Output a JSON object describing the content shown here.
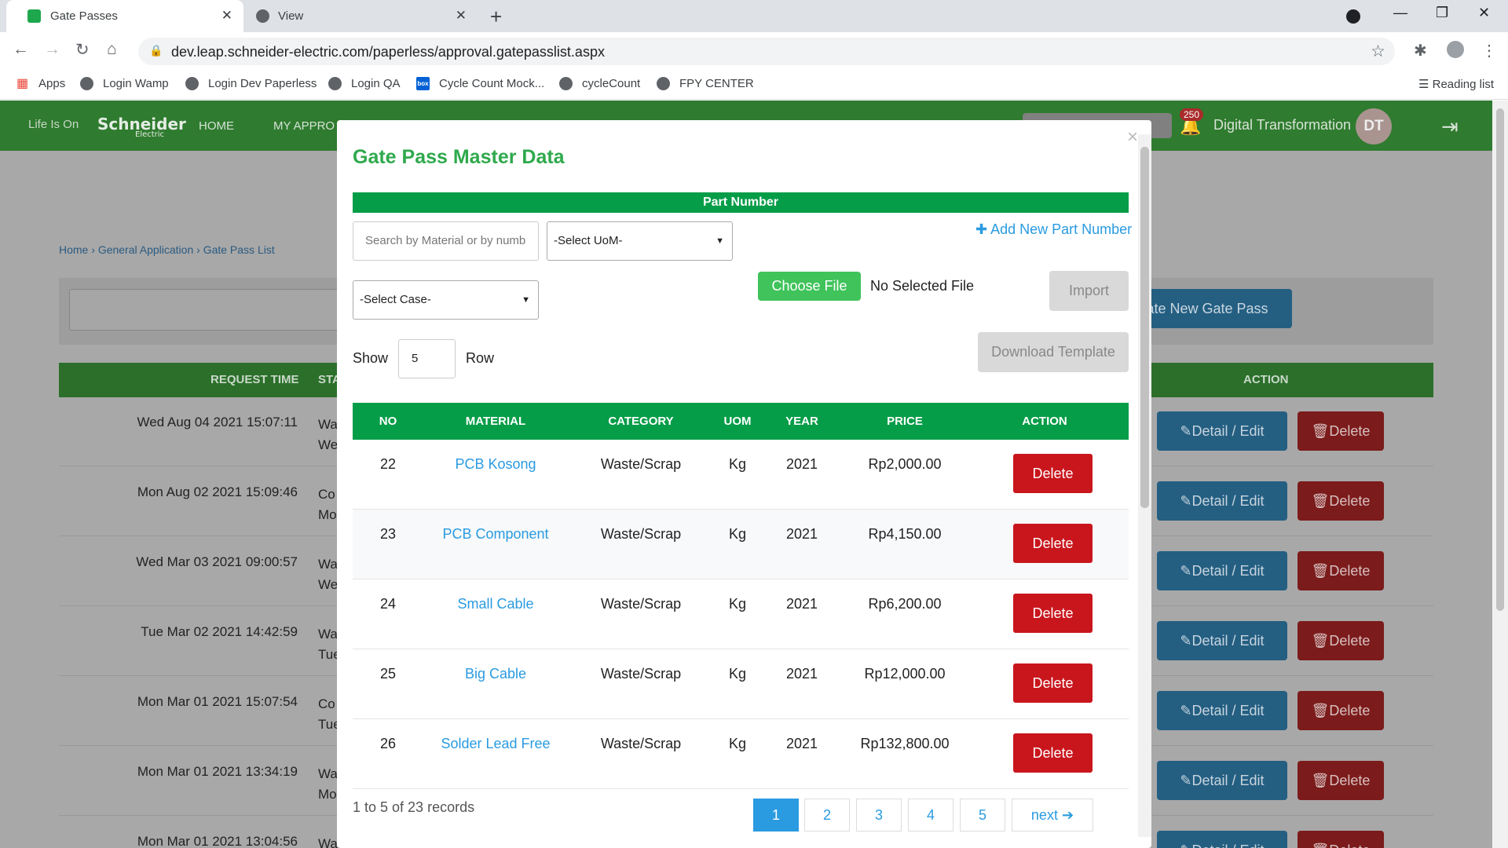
{
  "browser": {
    "tabs": [
      {
        "label": "Gate Passes",
        "favicon_color": "#1ea84e"
      },
      {
        "label": "View"
      }
    ],
    "url": "dev.leap.schneider-electric.com/paperless/approval.gatepasslist.aspx",
    "bookmarks": [
      "Apps",
      "Login Wamp",
      "Login Dev Paperless",
      "Login QA",
      "Cycle Count Mock...",
      "cycleCount",
      "FPY CENTER"
    ],
    "reading_list": "Reading list"
  },
  "topnav": {
    "tagline": "Life Is On",
    "brand": "Schneider",
    "brand_sub": "Electric",
    "links": [
      "HOME",
      "MY APPRO"
    ],
    "notification_count": "250",
    "user_name": "Digital Transformation",
    "avatar_initials": "DT"
  },
  "page": {
    "breadcrumb": [
      "Home",
      "General Application",
      "Gate Pass List"
    ],
    "create_button": "Create New Gate Pass",
    "table_headers": {
      "request_time": "REQUEST TIME",
      "status": "STA",
      "action": "ACTION"
    },
    "rows": [
      {
        "time": "Wed Aug 04 2021 15:07:11",
        "status": [
          "Wa",
          "We"
        ]
      },
      {
        "time": "Mon Aug 02 2021 15:09:46",
        "status": [
          "Co",
          "Mo"
        ]
      },
      {
        "time": "Wed Mar 03 2021 09:00:57",
        "status": [
          "Wa",
          "We"
        ]
      },
      {
        "time": "Tue Mar 02 2021 14:42:59",
        "status": [
          "Wa",
          "Tue"
        ]
      },
      {
        "time": "Mon Mar 01 2021 15:07:54",
        "status": [
          "Co",
          "Tue"
        ]
      },
      {
        "time": "Mon Mar 01 2021 13:34:19",
        "status": [
          "Wa",
          "Mo"
        ]
      },
      {
        "time": "Mon Mar 01 2021 13:04:56",
        "status": [
          "Waiting Approval",
          ""
        ]
      }
    ],
    "detail_label": "Detail / Edit",
    "delete_label": "Delete"
  },
  "modal": {
    "title": "Gate Pass Master Data",
    "section": "Part Number",
    "search_placeholder": "Search by Material or by numb",
    "uom_select": "-Select UoM-",
    "case_select": "-Select Case-",
    "add_new": "Add New Part Number",
    "choose_file": "Choose File",
    "no_file": "No Selected File",
    "import": "Import",
    "download_template": "Download Template",
    "show_label": "Show",
    "show_value": "5",
    "row_label": "Row",
    "columns": [
      "NO",
      "MATERIAL",
      "CATEGORY",
      "UOM",
      "YEAR",
      "PRICE",
      "ACTION"
    ],
    "rows": [
      {
        "no": "22",
        "material": "PCB Kosong",
        "category": "Waste/Scrap",
        "uom": "Kg",
        "year": "2021",
        "price": "Rp2,000.00"
      },
      {
        "no": "23",
        "material": "PCB Component",
        "category": "Waste/Scrap",
        "uom": "Kg",
        "year": "2021",
        "price": "Rp4,150.00"
      },
      {
        "no": "24",
        "material": "Small Cable",
        "category": "Waste/Scrap",
        "uom": "Kg",
        "year": "2021",
        "price": "Rp6,200.00"
      },
      {
        "no": "25",
        "material": "Big Cable",
        "category": "Waste/Scrap",
        "uom": "Kg",
        "year": "2021",
        "price": "Rp12,000.00"
      },
      {
        "no": "26",
        "material": "Solder Lead Free",
        "category": "Waste/Scrap",
        "uom": "Kg",
        "year": "2021",
        "price": "Rp132,800.00"
      }
    ],
    "delete_label": "Delete",
    "records_text": "1 to 5 of 23 records",
    "pages": [
      "1",
      "2",
      "3",
      "4",
      "5"
    ],
    "next_label": "next"
  }
}
